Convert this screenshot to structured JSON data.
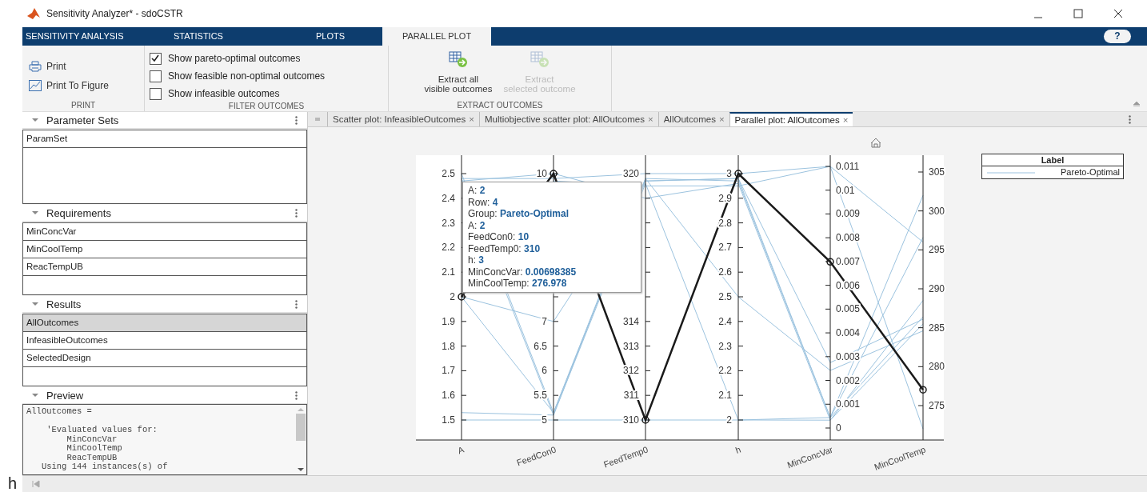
{
  "stray_label": "h",
  "window": {
    "title": "Sensitivity Analyzer* - sdoCSTR"
  },
  "ribbon": {
    "tabs": [
      {
        "label": "SENSITIVITY ANALYSIS",
        "selected": false
      },
      {
        "label": "STATISTICS",
        "selected": false
      },
      {
        "label": "PLOTS",
        "selected": false
      },
      {
        "label": "PARALLEL PLOT",
        "selected": true
      }
    ],
    "help": "?",
    "groups": [
      {
        "title": "PRINT",
        "items": [
          {
            "kind": "button",
            "label": "Print"
          },
          {
            "kind": "button",
            "label": "Print To Figure"
          }
        ]
      },
      {
        "title": "FILTER OUTCOMES",
        "items": [
          {
            "kind": "checkbox",
            "label": "Show pareto-optimal outcomes",
            "checked": true
          },
          {
            "kind": "checkbox",
            "label": "Show feasible non-optimal outcomes",
            "checked": false
          },
          {
            "kind": "checkbox",
            "label": "Show infeasible outcomes",
            "checked": false
          }
        ]
      },
      {
        "title": "EXTRACT OUTCOMES",
        "items": [
          {
            "kind": "large_button",
            "lines": [
              "Extract all",
              "visible outcomes"
            ],
            "disabled": false
          },
          {
            "kind": "large_button",
            "lines": [
              "Extract",
              "selected outcome"
            ],
            "disabled": true
          }
        ]
      }
    ]
  },
  "panels": [
    {
      "title": "Parameter Sets",
      "items": [
        {
          "label": "ParamSet",
          "selected": false
        }
      ]
    },
    {
      "title": "Requirements",
      "items": [
        {
          "label": "MinConcVar",
          "selected": false
        },
        {
          "label": "MinCoolTemp",
          "selected": false
        },
        {
          "label": "ReacTempUB",
          "selected": false
        }
      ]
    },
    {
      "title": "Results",
      "items": [
        {
          "label": "AllOutcomes",
          "selected": true
        },
        {
          "label": "InfeasibleOutcomes",
          "selected": false
        },
        {
          "label": "SelectedDesign",
          "selected": false
        }
      ]
    }
  ],
  "preview": {
    "title": "Preview",
    "text": "AllOutcomes =\n\n    'Evaluated values for:\n        MinConcVar\n        MinCoolTemp\n        ReacTempUB\n   Using 144 instances(s) of"
  },
  "documents": {
    "tabs": [
      {
        "label": "Scatter plot: InfeasibleOutcomes",
        "selected": false
      },
      {
        "label": "Multiobjective scatter plot: AllOutcomes",
        "selected": false
      },
      {
        "label": "AllOutcomes",
        "selected": false
      },
      {
        "label": "Parallel plot: AllOutcomes",
        "selected": true
      }
    ],
    "close": "×"
  },
  "plot": {
    "axes": [
      {
        "name": "A",
        "ticks": [
          "2.5",
          "2.4",
          "2.3",
          "2.2",
          "2.1",
          "2",
          "1.9",
          "1.8",
          "1.7",
          "1.6",
          "1.5"
        ]
      },
      {
        "name": "FeedCon0",
        "ticks_upper": [
          "10"
        ],
        "ticks_lower": [
          "7",
          "6.5",
          "6",
          "5.5",
          "5"
        ]
      },
      {
        "name": "FeedTemp0",
        "ticks_upper": [
          "320"
        ],
        "ticks_lower": [
          "314",
          "313",
          "312",
          "311",
          "310"
        ]
      },
      {
        "name": "h",
        "ticks": [
          "3",
          "2.9",
          "2.8",
          "2.7",
          "2.6",
          "2.5",
          "2.4",
          "2.3",
          "2.2",
          "2.1",
          "2"
        ]
      },
      {
        "name": "MinConcVar",
        "ticks": [
          "0.011",
          "0.01",
          "0.009",
          "0.008",
          "0.007",
          "0.006",
          "0.005",
          "0.004",
          "0.003",
          "0.002",
          "0.001",
          "0"
        ]
      },
      {
        "name": "MinCoolTemp",
        "ticks": [
          "305",
          "300",
          "295",
          "290",
          "285",
          "280",
          "275"
        ]
      }
    ],
    "tooltip": [
      {
        "label": "A:",
        "value": "2"
      },
      {
        "label": "Row:",
        "value": "4"
      },
      {
        "label": "Group:",
        "value": "Pareto-Optimal"
      },
      {
        "label": "A:",
        "value": "2"
      },
      {
        "label": "FeedCon0:",
        "value": "10"
      },
      {
        "label": "FeedTemp0:",
        "value": "310"
      },
      {
        "label": "h:",
        "value": "3"
      },
      {
        "label": "MinConcVar:",
        "value": "0.00698385"
      },
      {
        "label": "MinCoolTemp:",
        "value": "276.978"
      }
    ],
    "legend": {
      "title": "Label",
      "entries": [
        "Pareto-Optimal"
      ]
    }
  }
}
